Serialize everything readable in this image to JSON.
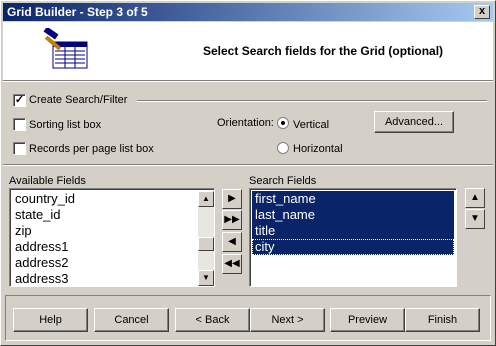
{
  "window": {
    "title": "Grid Builder - Step 3 of 5",
    "close_symbol": "x"
  },
  "header": {
    "text": "Select Search fields for the Grid (optional)",
    "icon": "grid-wizard-icon"
  },
  "options": {
    "create_search": {
      "label": "Create Search/Filter",
      "checked": true
    },
    "sorting": {
      "label": "Sorting list box",
      "checked": false
    },
    "records_per_page": {
      "label": "Records per page list box",
      "checked": false
    },
    "orientation_label": "Orientation:",
    "orientation_vertical": {
      "label": "Vertical",
      "selected": true
    },
    "orientation_horizontal": {
      "label": "Horizontal",
      "selected": false
    },
    "advanced_label": "Advanced..."
  },
  "available": {
    "label": "Available Fields",
    "items": [
      "country_id",
      "state_id",
      "zip",
      "address1",
      "address2",
      "address3"
    ]
  },
  "search": {
    "label": "Search Fields",
    "items": [
      "first_name",
      "last_name",
      "title",
      "city"
    ]
  },
  "footer": {
    "help": "Help",
    "cancel": "Cancel",
    "back": "< Back",
    "next": "Next >",
    "preview": "Preview",
    "finish": "Finish"
  }
}
